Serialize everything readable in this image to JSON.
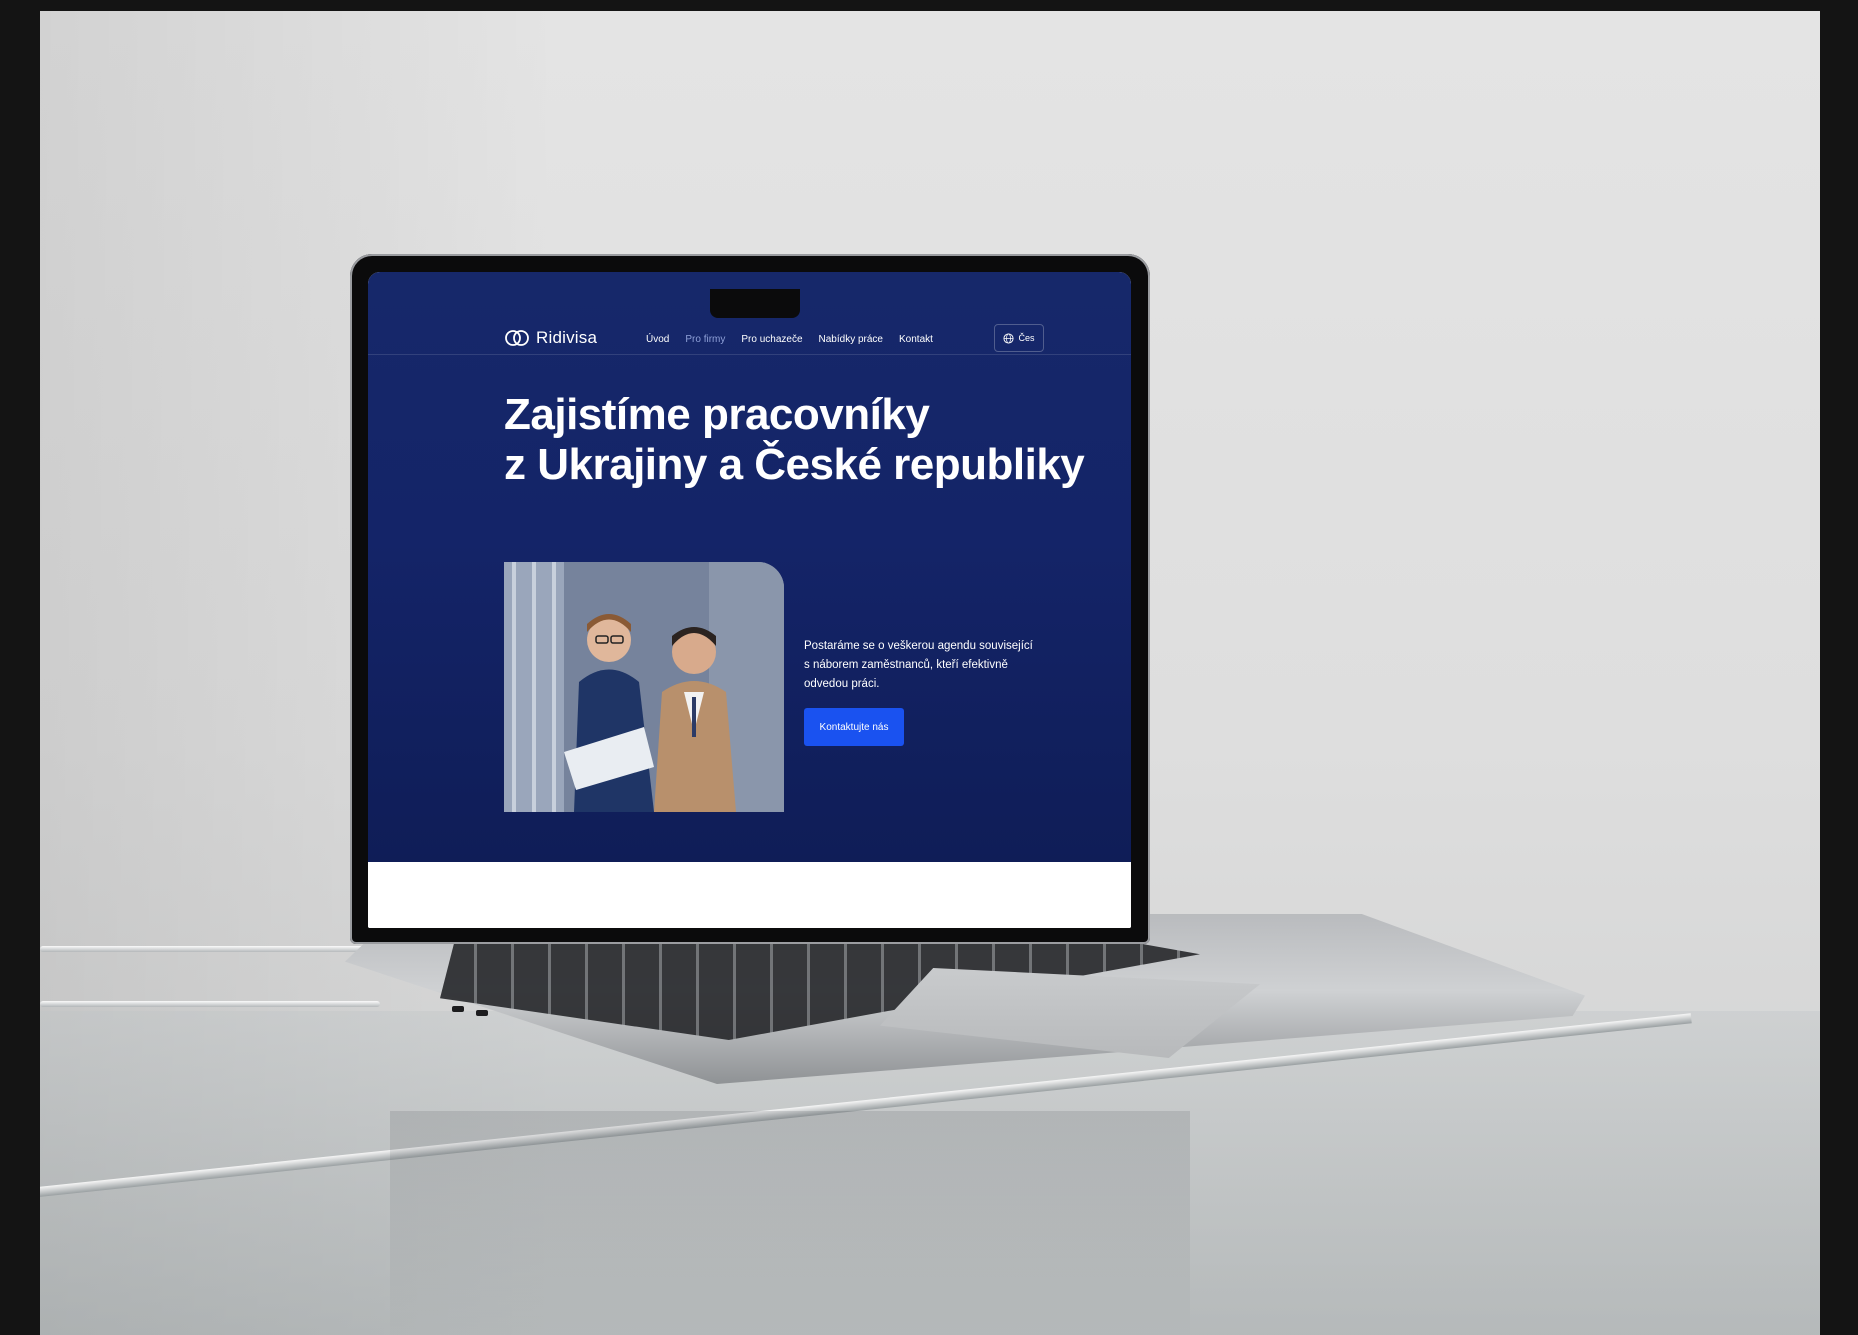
{
  "site": {
    "brand_name": "Ridivisa",
    "nav": {
      "items": [
        {
          "label": "Úvod",
          "active": false
        },
        {
          "label": "Pro firmy",
          "active": true
        },
        {
          "label": "Pro uchazeče",
          "active": false
        },
        {
          "label": "Nabídky práce",
          "active": false
        },
        {
          "label": "Kontakt",
          "active": false
        }
      ],
      "language_label": "Čes"
    },
    "hero": {
      "headline_line1": "Zajistíme pracovníky",
      "headline_line2": "z Ukrajiny a České republiky",
      "description": "Postaráme se o veškerou agendu související s náborem zaměstnanců, kteří efektivně odvedou práci.",
      "cta_label": "Kontaktujte nás"
    }
  },
  "colors": {
    "hero_background": "#16286a",
    "cta_blue": "#1a52f0",
    "nav_inactive": "#8fa0d8"
  },
  "icons": [
    "rings-logo-icon",
    "globe-icon"
  ]
}
